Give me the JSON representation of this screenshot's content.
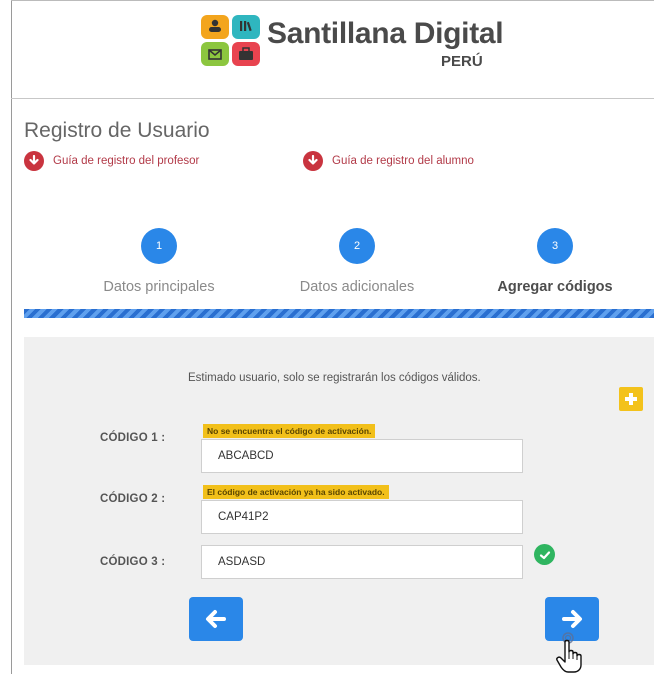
{
  "brand": {
    "title": "Santillana Digital",
    "subtitle": "PERÚ"
  },
  "page": {
    "title": "Registro de Usuario"
  },
  "guides": [
    {
      "label": "Guía de registro del profesor",
      "icon": "download-icon"
    },
    {
      "label": "Guía de registro del alumno",
      "icon": "download-icon"
    }
  ],
  "steps": [
    {
      "number": "1",
      "label": "Datos principales"
    },
    {
      "number": "2",
      "label": "Datos adicionales"
    },
    {
      "number": "3",
      "label": "Agregar códigos",
      "active": true
    }
  ],
  "notice": "Estimado usuario, solo se registrarán los códigos válidos.",
  "codes": [
    {
      "label": "CÓDIGO 1 :",
      "value": "ABCABCD",
      "warning": "No se encuentra el código de activación."
    },
    {
      "label": "CÓDIGO 2 :",
      "value": "CAP41P2",
      "warning": "El código de activación ya ha sido activado."
    },
    {
      "label": "CÓDIGO 3 :",
      "value": "ASDASD",
      "status": "valid"
    }
  ],
  "colors": {
    "primary": "#2a87e8",
    "warning": "#f2c01a",
    "success": "#2fb560",
    "guide_text": "#b23a48",
    "panel_bg": "#f0f0f0"
  },
  "icons": {
    "add": "plus-icon",
    "back": "arrow-left-icon",
    "next": "arrow-right-icon",
    "valid": "check-circle-icon",
    "cursor": "hand-pointer-icon"
  }
}
